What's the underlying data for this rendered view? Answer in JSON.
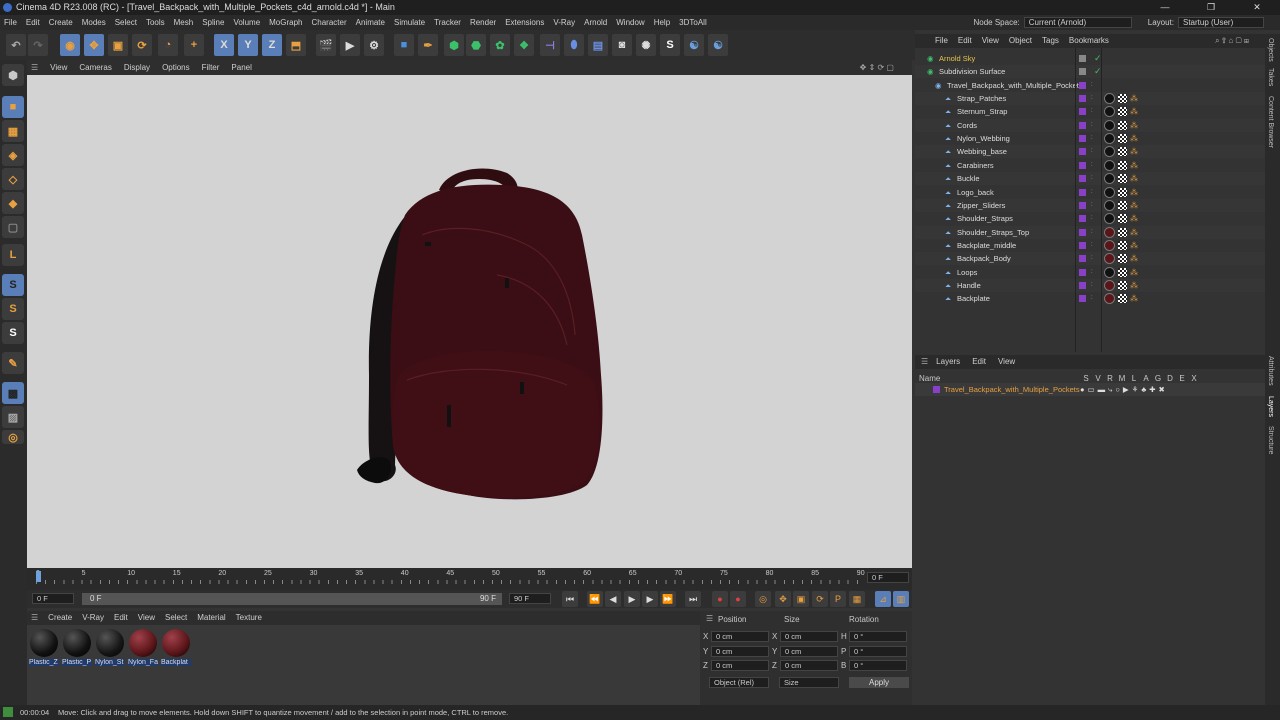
{
  "title": "Cinema 4D R23.008 (RC) - [Travel_Backpack_with_Multiple_Pockets_c4d_arnold.c4d *] - Main",
  "window_buttons": [
    "—",
    "❐",
    "✕"
  ],
  "menu": [
    "File",
    "Edit",
    "Create",
    "Modes",
    "Select",
    "Tools",
    "Mesh",
    "Spline",
    "Volume",
    "MoGraph",
    "Character",
    "Animate",
    "Simulate",
    "Tracker",
    "Render",
    "Extensions",
    "V-Ray",
    "Arnold",
    "Window",
    "Help",
    "3DToAll"
  ],
  "node_space": {
    "label": "Node Space:",
    "value": "Current (Arnold)"
  },
  "layout": {
    "label": "Layout:",
    "value": "Startup (User)"
  },
  "toolbar_icons": [
    "undo-icon",
    "redo-icon",
    "live-select-icon",
    "move-icon",
    "scale-icon",
    "rotate-icon",
    "recent-tools-icon",
    "add-icon",
    "x-axis-icon",
    "y-axis-icon",
    "z-axis-icon",
    "coordinate-system-icon",
    "render-region-icon",
    "render-view-icon",
    "render-settings-icon",
    "cube-icon",
    "pen-icon",
    "subdivision-icon",
    "extrude-icon",
    "cloner-icon",
    "mograph-icon",
    "bend-icon",
    "scene-icon",
    "floor-icon",
    "camera-icon",
    "light-icon",
    "arnold-icon",
    "python-icon",
    "python2-icon"
  ],
  "viewport_menu": [
    "View",
    "Cameras",
    "Display",
    "Options",
    "Filter",
    "Panel"
  ],
  "timeline": {
    "ticks": [
      "0",
      "5",
      "10",
      "15",
      "20",
      "25",
      "30",
      "35",
      "40",
      "45",
      "50",
      "55",
      "60",
      "65",
      "70",
      "75",
      "80",
      "85",
      "90"
    ],
    "current_frame": "0 F",
    "start": "0 F",
    "range_start": "0 F",
    "range_end": "90 F",
    "end": "90 F"
  },
  "material_menu": [
    "Create",
    "V-Ray",
    "Edit",
    "View",
    "Select",
    "Material",
    "Texture"
  ],
  "materials": [
    {
      "name": "Plastic_Z",
      "color": "#111111"
    },
    {
      "name": "Plastic_P",
      "color": "#111111"
    },
    {
      "name": "Nylon_St",
      "color": "#151515"
    },
    {
      "name": "Nylon_Fa",
      "color": "#5a1518"
    },
    {
      "name": "Backplat",
      "color": "#5a1518"
    }
  ],
  "coords": {
    "headers": [
      "Position",
      "Size",
      "Rotation"
    ],
    "rows": [
      {
        "axis": "X",
        "pos": "0 cm",
        "size_axis": "X",
        "size": "0 cm",
        "rot_axis": "H",
        "rot": "0 °"
      },
      {
        "axis": "Y",
        "pos": "0 cm",
        "size_axis": "Y",
        "size": "0 cm",
        "rot_axis": "P",
        "rot": "0 °"
      },
      {
        "axis": "Z",
        "pos": "0 cm",
        "size_axis": "Z",
        "size": "0 cm",
        "rot_axis": "B",
        "rot": "0 °"
      }
    ],
    "mode": "Object (Rel)",
    "size_mode": "Size",
    "apply": "Apply"
  },
  "status": {
    "time": "00:00:04",
    "message": "Move: Click and drag to move elements. Hold down SHIFT to quantize movement / add to the selection in point mode, CTRL to remove."
  },
  "object_menu": [
    "File",
    "Edit",
    "View",
    "Object",
    "Tags",
    "Bookmarks"
  ],
  "objects": [
    {
      "name": "Arnold Sky",
      "indent": 0,
      "color": "#e8c34a",
      "tag": "none"
    },
    {
      "name": "Subdivision Surface",
      "indent": 0,
      "color": "#dddddd",
      "tag": "none"
    },
    {
      "name": "Travel_Backpack_with_Multiple_Pockets",
      "indent": 1,
      "color": "#dddddd",
      "tag": "none"
    },
    {
      "name": "Strap_Patches",
      "indent": 2,
      "color": "#dddddd",
      "tag": "black"
    },
    {
      "name": "Sternum_Strap",
      "indent": 2,
      "color": "#dddddd",
      "tag": "black"
    },
    {
      "name": "Cords",
      "indent": 2,
      "color": "#dddddd",
      "tag": "black"
    },
    {
      "name": "Nylon_Webbing",
      "indent": 2,
      "color": "#dddddd",
      "tag": "black"
    },
    {
      "name": "Webbing_base",
      "indent": 2,
      "color": "#dddddd",
      "tag": "black"
    },
    {
      "name": "Carabiners",
      "indent": 2,
      "color": "#dddddd",
      "tag": "black"
    },
    {
      "name": "Buckle",
      "indent": 2,
      "color": "#dddddd",
      "tag": "black"
    },
    {
      "name": "Logo_back",
      "indent": 2,
      "color": "#dddddd",
      "tag": "black"
    },
    {
      "name": "Zipper_Sliders",
      "indent": 2,
      "color": "#dddddd",
      "tag": "black"
    },
    {
      "name": "Shoulder_Straps",
      "indent": 2,
      "color": "#dddddd",
      "tag": "black"
    },
    {
      "name": "Shoulder_Straps_Top",
      "indent": 2,
      "color": "#dddddd",
      "tag": "red"
    },
    {
      "name": "Backplate_middle",
      "indent": 2,
      "color": "#dddddd",
      "tag": "red"
    },
    {
      "name": "Backpack_Body",
      "indent": 2,
      "color": "#dddddd",
      "tag": "red"
    },
    {
      "name": "Loops",
      "indent": 2,
      "color": "#dddddd",
      "tag": "black"
    },
    {
      "name": "Handle",
      "indent": 2,
      "color": "#dddddd",
      "tag": "red"
    },
    {
      "name": "Backplate",
      "indent": 2,
      "color": "#dddddd",
      "tag": "red"
    }
  ],
  "layers_menu": [
    "Layers",
    "Edit",
    "View"
  ],
  "layers_header": {
    "name": "Name",
    "flags": [
      "S",
      "V",
      "R",
      "M",
      "L",
      "A",
      "G",
      "D",
      "E",
      "X"
    ]
  },
  "layers": [
    {
      "name": "Travel_Backpack_with_Multiple_Pockets",
      "color": "#8a3fc9"
    }
  ],
  "right_tabs": [
    "Objects",
    "Takes",
    "Content Browser",
    "Attributes",
    "Layers",
    "Structure"
  ]
}
